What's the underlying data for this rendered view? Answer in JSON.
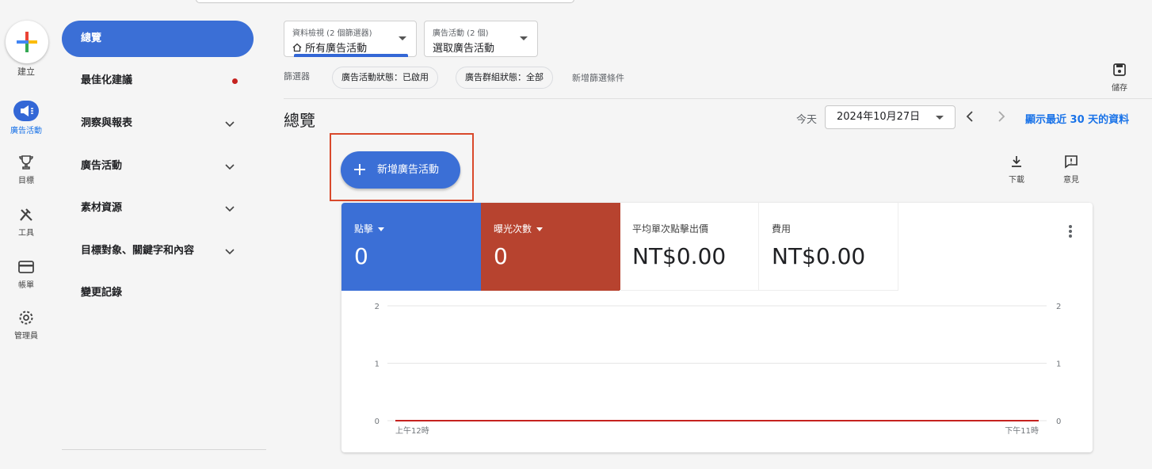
{
  "rail": {
    "create": "建立",
    "items": [
      {
        "label": "廣告活動",
        "icon": "megaphone-icon"
      },
      {
        "label": "目標",
        "icon": "trophy-icon"
      },
      {
        "label": "工具",
        "icon": "tools-icon"
      },
      {
        "label": "帳單",
        "icon": "credit-card-icon"
      },
      {
        "label": "管理員",
        "icon": "gear-icon"
      }
    ]
  },
  "nav": {
    "items": [
      {
        "label": "總覽"
      },
      {
        "label": "最佳化建議"
      },
      {
        "label": "洞察與報表"
      },
      {
        "label": "廣告活動"
      },
      {
        "label": "素材資源"
      },
      {
        "label": "目標對象、關鍵字和內容"
      },
      {
        "label": "變更記錄"
      }
    ]
  },
  "filters": {
    "view_small": "資料檢視 (2 個篩選器)",
    "view_value": "所有廣告活動",
    "campaign_small": "廣告活動 (2 個)",
    "campaign_value": "選取廣告活動",
    "filter_label": "篩選器",
    "chips": [
      "廣告活動狀態：已啟用",
      "廣告群組狀態：全部"
    ],
    "add_filter": "新增篩選條件",
    "save": "儲存"
  },
  "header": {
    "title": "總覽",
    "today": "今天",
    "date": "2024年10月27日",
    "show_30": "顯示最近 30 天的資料"
  },
  "actions": {
    "new_campaign": "新增廣告活動",
    "download": "下載",
    "feedback": "意見"
  },
  "metrics": [
    {
      "label": "點擊",
      "value": "0"
    },
    {
      "label": "曝光次數",
      "value": "0"
    },
    {
      "label": "平均單次點擊出價",
      "value": "NT$0.00"
    },
    {
      "label": "費用",
      "value": "NT$0.00"
    }
  ],
  "chart_data": {
    "type": "line",
    "x": [
      "上午12時",
      "下午11時"
    ],
    "series": [
      {
        "values": [
          0,
          0
        ],
        "color": "#c5221f"
      }
    ],
    "ylim": [
      0,
      2
    ],
    "yticks": [
      "2",
      "1",
      "0"
    ],
    "grid": true
  },
  "colors": {
    "accent": "#3b6fd6",
    "metric_blue": "#3b6fd6",
    "metric_red": "#b7432f",
    "highlight": "#d9492b"
  }
}
